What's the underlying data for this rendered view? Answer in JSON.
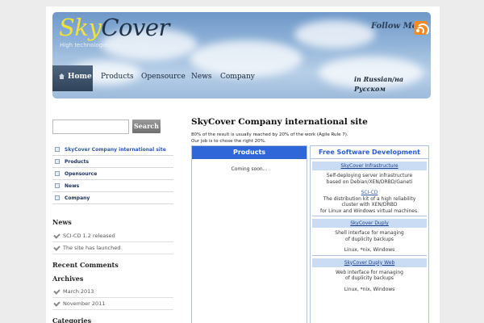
{
  "header": {
    "logo_part1": "Sky",
    "logo_part2": "Cover",
    "slogan": "High technologies are accesible!",
    "follow_label": "Follow Me"
  },
  "nav": {
    "items": [
      "Home",
      "Products",
      "Opensource",
      "News",
      "Company"
    ],
    "lang_link": "in Russian/на Русском"
  },
  "search": {
    "placeholder": "",
    "button_label": "Search"
  },
  "sidebar": {
    "menu": [
      "SkyCover Company international site",
      "Products",
      "Opensource",
      "News",
      "Company"
    ],
    "news_heading": "News",
    "news": [
      "SCI-CD 1.2 released",
      "The site has launched"
    ],
    "recent_comments_heading": "Recent Comments",
    "archives_heading": "Archives",
    "archives": [
      "March 2013",
      "November 2011"
    ],
    "categories_heading": "Categories"
  },
  "content": {
    "title": "SkyCover Company international site",
    "intro_line1": "80% of the result is usually reached by 20% of the work (Agile Rule 7).",
    "intro_line2": "Our job is to chose the right 20%.",
    "products": {
      "heading": "Products",
      "body": "Coming soon..."
    },
    "fsd": {
      "heading": "Free Software Development",
      "items": [
        {
          "title": "SkyCover Infrastructure",
          "lines": [
            "Self-deploying server infrastructure",
            "based on Debian/XEN/DRBD/Ganeti"
          ],
          "link": "SCI-CD",
          "link_lines": [
            "The distribution kit of a high reliability",
            "cluster with XEN/DRBD",
            "for Linux and Windows virtual machines."
          ]
        },
        {
          "title": "SkyCover Duply",
          "lines": [
            "Shell interface for managing",
            "of duplicity backups"
          ],
          "platforms": "Linux, *nix, Windows"
        },
        {
          "title": "SkyCover Duply Web",
          "lines": [
            "Web interface for managing",
            "of duplicity backups"
          ],
          "platforms": "Linux, *nix, Windows"
        }
      ]
    }
  },
  "colors": {
    "page_bg": "#ececec",
    "accent_blue": "#2f67d8",
    "nav_active": "#3f546d",
    "rss_orange": "#f08a24",
    "logo_yellow": "#f1e23a"
  },
  "icons": [
    "home-icon",
    "rss-icon",
    "menu-item-icon",
    "check-icon"
  ]
}
